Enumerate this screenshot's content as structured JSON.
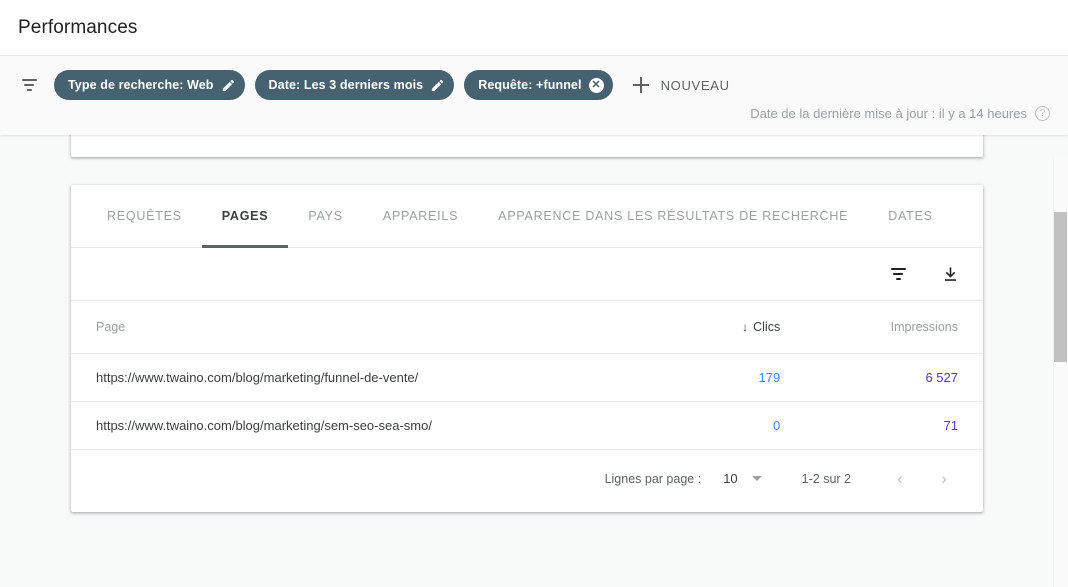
{
  "header": {
    "title": "Performances"
  },
  "filters": {
    "filter_icon_name": "filter-icon",
    "chips": [
      {
        "label": "Type de recherche: Web",
        "action": "edit"
      },
      {
        "label": "Date: Les 3 derniers mois",
        "action": "edit"
      },
      {
        "label": "Requête: +funnel",
        "action": "remove"
      }
    ],
    "new_button_label": "NOUVEAU",
    "last_update_text": "Date de la dernière mise à jour : il y a 14 heures"
  },
  "tabs": [
    {
      "label": "REQUÊTES",
      "active": false
    },
    {
      "label": "PAGES",
      "active": true
    },
    {
      "label": "PAYS",
      "active": false
    },
    {
      "label": "APPAREILS",
      "active": false
    },
    {
      "label": "APPARENCE DANS LES RÉSULTATS DE RECHERCHE",
      "active": false
    },
    {
      "label": "DATES",
      "active": false
    }
  ],
  "table_toolbar": {
    "filter_icon_name": "filter-icon",
    "download_icon_name": "download-icon"
  },
  "table": {
    "columns": [
      "Page",
      "Clics",
      "Impressions"
    ],
    "sort": {
      "column": "Clics",
      "direction": "desc",
      "arrow": "↓"
    },
    "rows": [
      {
        "page": "https://www.twaino.com/blog/marketing/funnel-de-vente/",
        "clics": "179",
        "impressions": "6 527"
      },
      {
        "page": "https://www.twaino.com/blog/marketing/sem-seo-sea-smo/",
        "clics": "0",
        "impressions": "71"
      }
    ]
  },
  "pagination": {
    "rows_per_page_label": "Lignes par page :",
    "rows_per_page_value": "10",
    "range_label": "1-2 sur 2",
    "prev_label": "‹",
    "next_label": "›"
  },
  "colors": {
    "chip_bg": "#46616f",
    "clics": "#4285f4",
    "impressions": "#5e35b1",
    "page_bg": "#f8f9f9",
    "card_bg": "#ffffff",
    "muted_text": "#9aa0a6"
  }
}
